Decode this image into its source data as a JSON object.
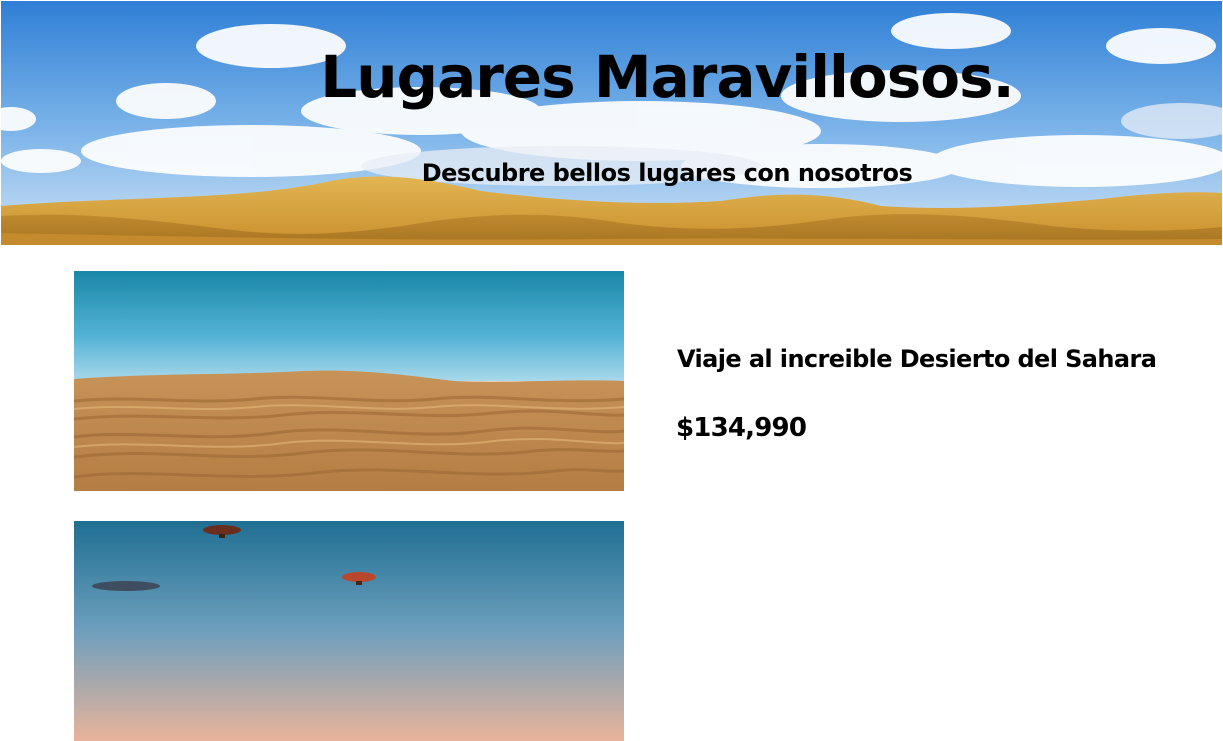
{
  "hero": {
    "title": "Lugares Maravillosos.",
    "subtitle": "Descubre bellos lugares con nosotros",
    "image": "desert-dunes-under-cloudy-sky"
  },
  "cards": [
    {
      "image": "sahara-sand-ripples",
      "title": "Viaje al increible Desierto del Sahara",
      "price": "$134,990"
    },
    {
      "image": "hot-air-balloons-over-desert"
    }
  ],
  "colors": {
    "sky_blue": "#3a86d8",
    "sand": "#d9a84a",
    "page_background": "#ffffff",
    "text": "#000000"
  }
}
